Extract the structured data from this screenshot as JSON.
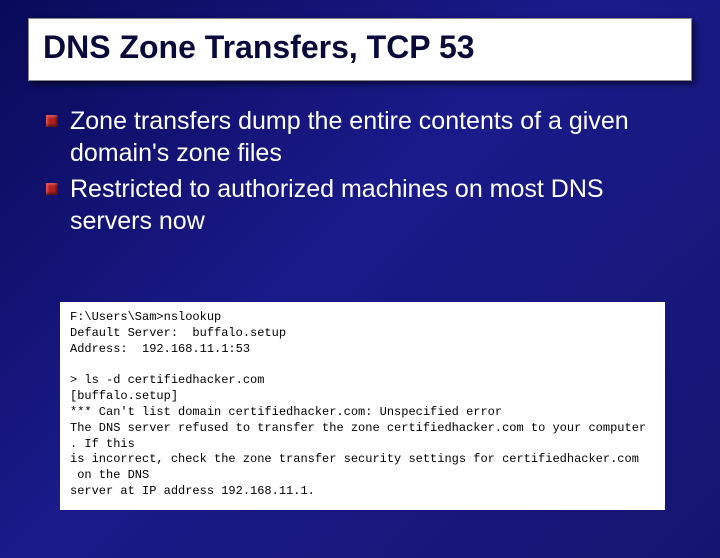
{
  "title": "DNS Zone Transfers, TCP 53",
  "bullets": [
    "Zone transfers dump the entire contents of a given domain's zone files",
    "Restricted to authorized machines on most DNS servers now"
  ],
  "terminal": {
    "line1": "F:\\Users\\Sam>nslookup",
    "line2": "Default Server:  buffalo.setup",
    "line3": "Address:  192.168.11.1:53",
    "line4": "",
    "line5": "> ls -d certifiedhacker.com",
    "line6": "[buffalo.setup]",
    "line7": "*** Can't list domain certifiedhacker.com: Unspecified error",
    "line8": "The DNS server refused to transfer the zone certifiedhacker.com to your computer",
    "line9": ". If this",
    "line10": "is incorrect, check the zone transfer security settings for certifiedhacker.com",
    "line11": " on the DNS",
    "line12": "server at IP address 192.168.11.1."
  }
}
